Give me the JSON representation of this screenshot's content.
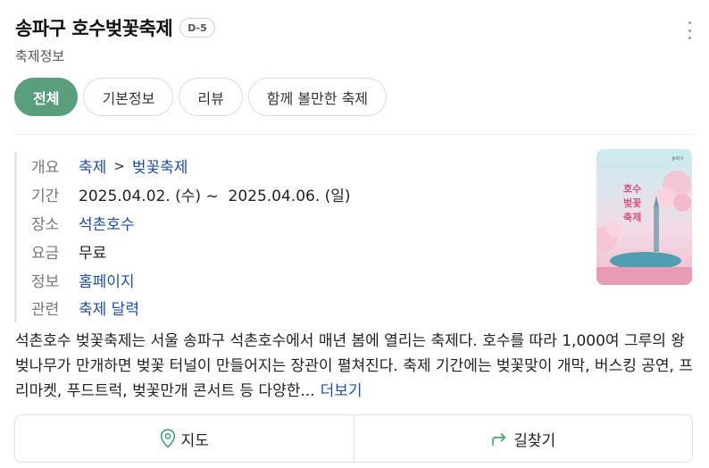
{
  "header": {
    "title": "송파구 호수벚꽃축제",
    "dday": "D-5",
    "subtitle": "축제정보"
  },
  "tabs": [
    {
      "label": "전체",
      "active": true
    },
    {
      "label": "기본정보",
      "active": false
    },
    {
      "label": "리뷰",
      "active": false
    },
    {
      "label": "함께 볼만한 축제",
      "active": false
    }
  ],
  "info": {
    "overview": {
      "label": "개요",
      "category": "축제",
      "separator": ">",
      "subcategory": "벚꽃축제"
    },
    "period": {
      "label": "기간",
      "value": "2025.04.02. (수) ~  2025.04.06. (일)"
    },
    "place": {
      "label": "장소",
      "value": "석촌호수"
    },
    "fee": {
      "label": "요금",
      "value": "무료"
    },
    "info": {
      "label": "정보",
      "value": "홈페이지"
    },
    "related": {
      "label": "관련",
      "value": "축제 달력"
    }
  },
  "poster": {
    "title": "호수벚꽃축제",
    "issuer": "송파구"
  },
  "description": {
    "text": "석촌호수 벚꽃축제는 서울 송파구 석촌호수에서 매년 봄에 열리는 축제다. 호수를 따라 1,000여 그루의 왕벚나무가 만개하면 벚꽃 터널이 만들어지는 장관이 펼쳐진다. 축제 기간에는 벚꽃맞이 개막, 버스킹 공연, 프리마켓, 푸드트럭, 벚꽃만개 콘서트 등 다양한...",
    "more": "더보기"
  },
  "actions": {
    "map": "지도",
    "directions": "길찾기"
  },
  "colors": {
    "accent": "#5a9e7d",
    "link": "#1d4ea3"
  }
}
